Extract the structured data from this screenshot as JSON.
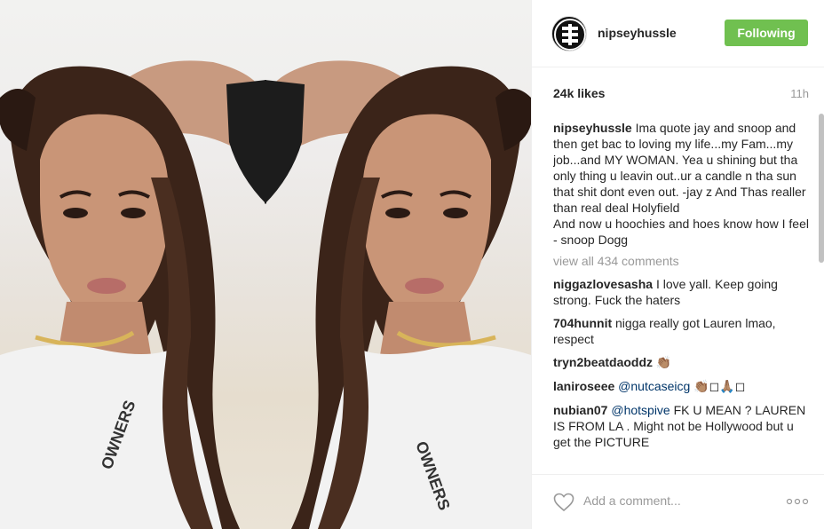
{
  "post": {
    "username": "nipseyhussle",
    "follow_label": "Following",
    "likes": "24k likes",
    "time": "11h",
    "caption_user": "nipseyhussle",
    "caption_text": "Ima quote jay and snoop and then get bac to loving my life...my Fam...my job...and MY WOMAN. Yea u shining but tha only thing u leavin out..ur a candle n tha sun that shit dont even out. -jay z And Thas realler than real deal Holyfield",
    "caption_text_2": "And now u hoochies and hoes know how I feel - snoop Dogg",
    "view_all": "view all 434 comments",
    "comments": [
      {
        "user": "niggazlovesasha",
        "text": "I love yall. Keep going strong. Fuck the haters"
      },
      {
        "user": "704hunnit",
        "text": "nigga really got Lauren lmao, respect"
      },
      {
        "user": "tryn2beatdaoddz",
        "text": "👏🏽"
      },
      {
        "user": "laniroseee",
        "mention": "@nutcaseicg",
        "text": "👏🏽◻🙏🏽◻"
      },
      {
        "user": "nubian07",
        "mention": "@hotspive",
        "text": "FK U MEAN ? LAUREN IS FROM LA . Might not be Hollywood but u get the PICTURE"
      }
    ],
    "add_comment_placeholder": "Add a comment...",
    "shirt_text": "OWNERS"
  },
  "icons": {
    "avatar": "brand-logo-avatar",
    "like": "heart-icon",
    "more": "more-options-icon"
  },
  "colors": {
    "follow_button": "#70c050",
    "mention": "#003569",
    "muted": "#999999"
  }
}
